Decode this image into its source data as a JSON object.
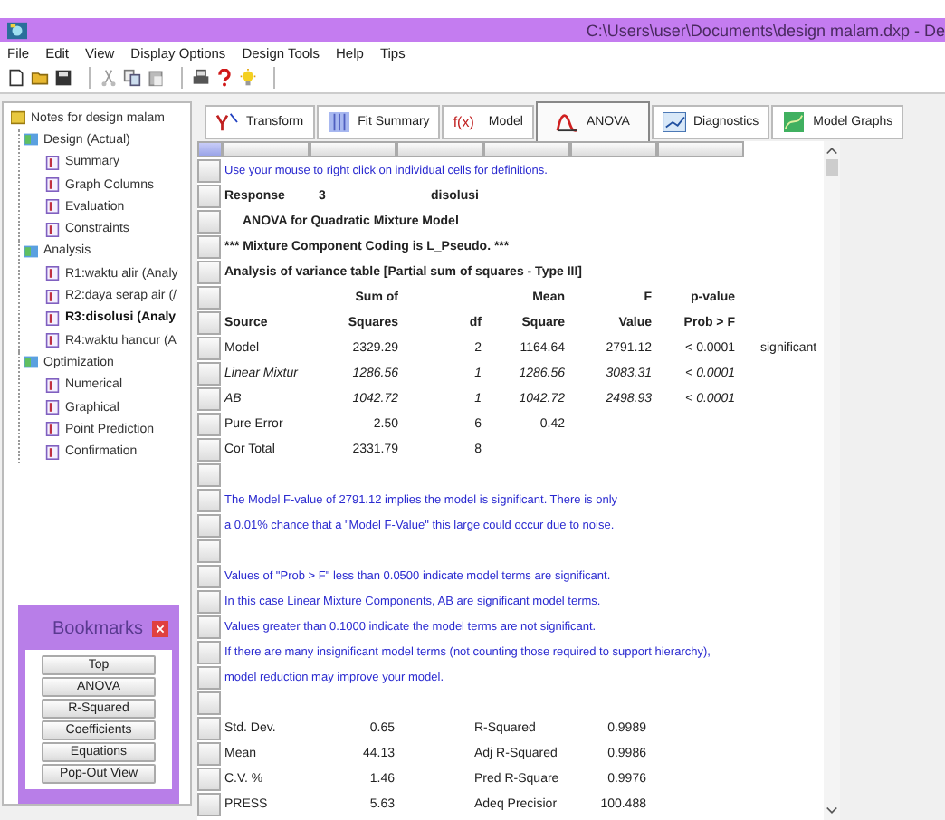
{
  "window": {
    "title": "C:\\Users\\user\\Documents\\design malam.dxp - De"
  },
  "menu": [
    "File",
    "Edit",
    "View",
    "Display Options",
    "Design Tools",
    "Help",
    "Tips"
  ],
  "tree": {
    "label": "Notes for design malam",
    "selected": false,
    "children": [
      {
        "label": "Design (Actual)",
        "selected": false,
        "children": [
          {
            "label": "Summary",
            "selected": false
          },
          {
            "label": "Graph Columns",
            "selected": false
          },
          {
            "label": "Evaluation",
            "selected": false
          },
          {
            "label": "Constraints",
            "selected": false
          }
        ]
      },
      {
        "label": "Analysis",
        "selected": false,
        "children": [
          {
            "label": "R1:waktu alir (Analy",
            "selected": false
          },
          {
            "label": "R2:daya serap air (/",
            "selected": false
          },
          {
            "label": "R3:disolusi (Analy",
            "selected": true
          },
          {
            "label": "R4:waktu hancur (A",
            "selected": false
          }
        ]
      },
      {
        "label": "Optimization",
        "selected": false,
        "children": [
          {
            "label": "Numerical",
            "selected": false
          },
          {
            "label": "Graphical",
            "selected": false
          },
          {
            "label": "Point Prediction",
            "selected": false
          },
          {
            "label": "Confirmation",
            "selected": false
          }
        ]
      }
    ]
  },
  "bookmarks": {
    "title": "Bookmarks",
    "buttons": [
      "Top",
      "ANOVA",
      "R-Squared",
      "Coefficients",
      "Equations",
      "Pop-Out View"
    ]
  },
  "tabs": [
    {
      "label": "Transform",
      "selected": false
    },
    {
      "label": "Fit Summary",
      "selected": false
    },
    {
      "prefix": "f(x)",
      "label": "Model",
      "selected": false
    },
    {
      "label": "ANOVA",
      "selected": true
    },
    {
      "label": "Diagnostics",
      "selected": false
    },
    {
      "label": "Model Graphs",
      "selected": false
    }
  ],
  "report": [
    {
      "kind": "note",
      "text": "Use your mouse to right click on individual cells for definitions."
    },
    {
      "kind": "response",
      "cells": [
        "Response",
        "3",
        "disolusi"
      ]
    },
    {
      "kind": "title",
      "text": "ANOVA for Quadratic Mixture Model"
    },
    {
      "kind": "heading",
      "text": "*** Mixture Component Coding is L_Pseudo. ***"
    },
    {
      "kind": "heading",
      "text": "Analysis of variance table [Partial sum of squares - Type III]"
    },
    {
      "kind": "table",
      "columns": [
        {
          "label": "Source"
        },
        {
          "label_top": "Sum of",
          "label": "Squares"
        },
        {
          "label": "df"
        },
        {
          "label_top": "Mean",
          "label": "Square"
        },
        {
          "label_top": "F",
          "label": "Value"
        },
        {
          "label_top": "p-value",
          "label": "Prob > F"
        }
      ],
      "rows": [
        {
          "italic": false,
          "cells": [
            "Model",
            "2329.29",
            "2",
            "1164.64",
            "2791.12",
            "< 0.0001",
            "significant"
          ]
        },
        {
          "italic": true,
          "cells": [
            "Linear Mixtur",
            "1286.56",
            "1",
            "1286.56",
            "3083.31",
            "< 0.0001"
          ]
        },
        {
          "italic": true,
          "cells": [
            "AB",
            "1042.72",
            "1",
            "1042.72",
            "2498.93",
            "< 0.0001"
          ]
        },
        {
          "italic": false,
          "cells": [
            "Pure Error",
            "2.50",
            "6",
            "0.42"
          ]
        },
        {
          "italic": false,
          "cells": [
            "Cor Total",
            "2331.79",
            "8"
          ]
        }
      ]
    },
    {
      "kind": "blank"
    },
    {
      "kind": "note",
      "text": "The Model F-value of 2791.12 implies the model is significant.  There is only"
    },
    {
      "kind": "note",
      "text": "a 0.01% chance that a \"Model F-Value\" this large could occur due to noise."
    },
    {
      "kind": "blank"
    },
    {
      "kind": "note",
      "text": "Values of \"Prob > F\" less than 0.0500 indicate model terms are significant."
    },
    {
      "kind": "note",
      "text": "In this case Linear Mixture Components, AB are significant model terms."
    },
    {
      "kind": "note",
      "text": "Values greater than 0.1000 indicate the model terms are not significant."
    },
    {
      "kind": "note",
      "text": "If there are many insignificant model terms (not counting those required to support hierarchy),"
    },
    {
      "kind": "note",
      "text": "model reduction may improve your model."
    },
    {
      "kind": "blank"
    },
    {
      "kind": "fit",
      "cells": [
        "Std. Dev.",
        "0.65",
        "R-Squared",
        "0.9989"
      ]
    },
    {
      "kind": "fit",
      "cells": [
        "Mean",
        "44.13",
        "Adj R-Squared",
        "0.9986"
      ]
    },
    {
      "kind": "fit",
      "cells": [
        "C.V. %",
        "1.46",
        "Pred R-Square",
        "0.9976"
      ]
    },
    {
      "kind": "fit",
      "cells": [
        "PRESS",
        "5.63",
        "Adeq Precisior",
        "100.488"
      ]
    }
  ]
}
